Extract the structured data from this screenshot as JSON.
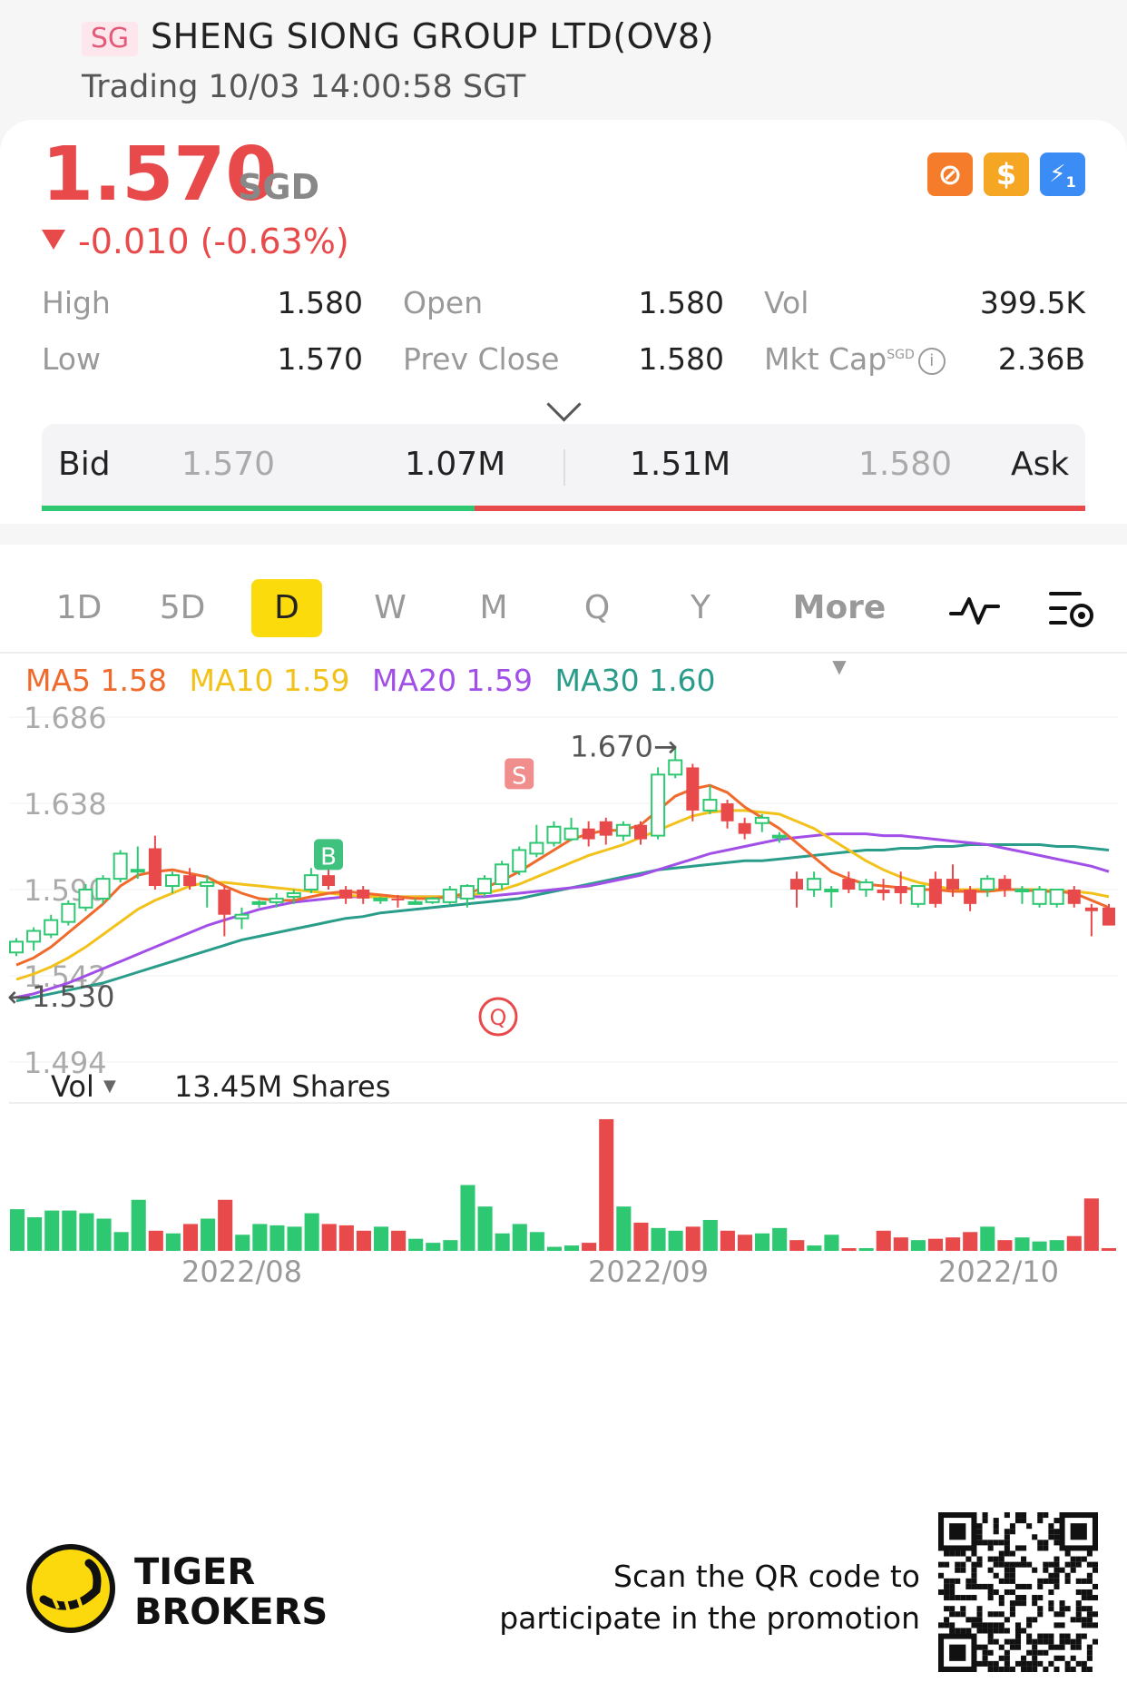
{
  "header": {
    "market_badge": "SG",
    "stock_name": "SHENG SIONG GROUP LTD(OV8)",
    "status": "Trading 10/03 14:00:58 SGT"
  },
  "quote": {
    "price": "1.570",
    "currency": "SGD",
    "change": "-0.010 (-0.63%)",
    "badges": [
      "prohibited-icon",
      "dollar-icon",
      "lightning-icon"
    ],
    "badge_colors": [
      "#f57c2b",
      "#f5a623",
      "#3b8cf5"
    ],
    "lightning_sub": "1"
  },
  "stats": {
    "high_label": "High",
    "high": "1.580",
    "low_label": "Low",
    "low": "1.570",
    "open_label": "Open",
    "open": "1.580",
    "prev_close_label": "Prev Close",
    "prev_close": "1.580",
    "vol_label": "Vol",
    "vol": "399.5K",
    "mkt_cap_label": "Mkt Cap",
    "mkt_cap_sup": "SGD",
    "mkt_cap": "2.36B"
  },
  "bidask": {
    "bid_label": "Bid",
    "bid_price": "1.570",
    "bid_size": "1.07M",
    "ask_size": "1.51M",
    "ask_price": "1.580",
    "ask_label": "Ask",
    "bid_ratio": 0.415
  },
  "tabs": [
    "1D",
    "5D",
    "D",
    "W",
    "M",
    "Q",
    "Y",
    "More"
  ],
  "active_tab": "D",
  "ma_legend": {
    "ma5": "MA5 1.58",
    "ma10": "MA10 1.59",
    "ma20": "MA20 1.59",
    "ma30": "MA30 1.60"
  },
  "chart_data": {
    "type": "candlestick",
    "y_ticks": [
      "1.686",
      "1.638",
      "1.590",
      "1.542",
      "1.494"
    ],
    "ylim": [
      1.494,
      1.686
    ],
    "annotations": {
      "high": "1.670",
      "low": "1.530",
      "buy": "B",
      "sell": "S",
      "q": "Q"
    },
    "x_labels": [
      "2022/08",
      "2022/09",
      "2022/10"
    ],
    "colors": {
      "up": "#2fc872",
      "down": "#e8494a",
      "ma5": "#f06a2c",
      "ma10": "#f2c21b",
      "ma20": "#a24fe8",
      "ma30": "#2a9d8a"
    },
    "candles": [
      {
        "o": 1.555,
        "h": 1.563,
        "l": 1.553,
        "c": 1.561
      },
      {
        "o": 1.561,
        "h": 1.569,
        "l": 1.556,
        "c": 1.567
      },
      {
        "o": 1.565,
        "h": 1.576,
        "l": 1.563,
        "c": 1.573
      },
      {
        "o": 1.572,
        "h": 1.584,
        "l": 1.57,
        "c": 1.582
      },
      {
        "o": 1.58,
        "h": 1.593,
        "l": 1.578,
        "c": 1.59
      },
      {
        "o": 1.585,
        "h": 1.598,
        "l": 1.582,
        "c": 1.596
      },
      {
        "o": 1.596,
        "h": 1.612,
        "l": 1.594,
        "c": 1.61
      },
      {
        "o": 1.6,
        "h": 1.614,
        "l": 1.596,
        "c": 1.601
      },
      {
        "o": 1.613,
        "h": 1.62,
        "l": 1.59,
        "c": 1.592
      },
      {
        "o": 1.592,
        "h": 1.6,
        "l": 1.588,
        "c": 1.598
      },
      {
        "o": 1.598,
        "h": 1.602,
        "l": 1.59,
        "c": 1.592
      },
      {
        "o": 1.592,
        "h": 1.598,
        "l": 1.58,
        "c": 1.594
      },
      {
        "o": 1.59,
        "h": 1.592,
        "l": 1.564,
        "c": 1.576
      },
      {
        "o": 1.574,
        "h": 1.58,
        "l": 1.568,
        "c": 1.576
      },
      {
        "o": 1.582,
        "h": 1.584,
        "l": 1.58,
        "c": 1.583
      },
      {
        "o": 1.583,
        "h": 1.588,
        "l": 1.58,
        "c": 1.585
      },
      {
        "o": 1.586,
        "h": 1.59,
        "l": 1.582,
        "c": 1.588
      },
      {
        "o": 1.59,
        "h": 1.602,
        "l": 1.588,
        "c": 1.598
      },
      {
        "o": 1.598,
        "h": 1.602,
        "l": 1.59,
        "c": 1.592
      },
      {
        "o": 1.59,
        "h": 1.592,
        "l": 1.582,
        "c": 1.585
      },
      {
        "o": 1.59,
        "h": 1.592,
        "l": 1.582,
        "c": 1.585
      },
      {
        "o": 1.585,
        "h": 1.586,
        "l": 1.582,
        "c": 1.585
      },
      {
        "o": 1.585,
        "h": 1.587,
        "l": 1.58,
        "c": 1.584
      },
      {
        "o": 1.583,
        "h": 1.585,
        "l": 1.582,
        "c": 1.583
      },
      {
        "o": 1.583,
        "h": 1.586,
        "l": 1.582,
        "c": 1.585
      },
      {
        "o": 1.583,
        "h": 1.592,
        "l": 1.582,
        "c": 1.59
      },
      {
        "o": 1.585,
        "h": 1.593,
        "l": 1.58,
        "c": 1.592
      },
      {
        "o": 1.588,
        "h": 1.598,
        "l": 1.586,
        "c": 1.596
      },
      {
        "o": 1.593,
        "h": 1.606,
        "l": 1.59,
        "c": 1.604
      },
      {
        "o": 1.6,
        "h": 1.614,
        "l": 1.598,
        "c": 1.612
      },
      {
        "o": 1.61,
        "h": 1.626,
        "l": 1.608,
        "c": 1.616
      },
      {
        "o": 1.616,
        "h": 1.628,
        "l": 1.614,
        "c": 1.625
      },
      {
        "o": 1.618,
        "h": 1.63,
        "l": 1.617,
        "c": 1.624
      },
      {
        "o": 1.624,
        "h": 1.628,
        "l": 1.614,
        "c": 1.618
      },
      {
        "o": 1.628,
        "h": 1.63,
        "l": 1.615,
        "c": 1.62
      },
      {
        "o": 1.62,
        "h": 1.628,
        "l": 1.617,
        "c": 1.626
      },
      {
        "o": 1.626,
        "h": 1.628,
        "l": 1.615,
        "c": 1.618
      },
      {
        "o": 1.62,
        "h": 1.658,
        "l": 1.618,
        "c": 1.654
      },
      {
        "o": 1.654,
        "h": 1.67,
        "l": 1.652,
        "c": 1.662
      },
      {
        "o": 1.658,
        "h": 1.66,
        "l": 1.628,
        "c": 1.634
      },
      {
        "o": 1.634,
        "h": 1.648,
        "l": 1.632,
        "c": 1.64
      },
      {
        "o": 1.638,
        "h": 1.64,
        "l": 1.624,
        "c": 1.628
      },
      {
        "o": 1.627,
        "h": 1.63,
        "l": 1.618,
        "c": 1.621
      },
      {
        "o": 1.627,
        "h": 1.632,
        "l": 1.622,
        "c": 1.63
      },
      {
        "o": 1.62,
        "h": 1.622,
        "l": 1.616,
        "c": 1.62
      },
      {
        "o": 1.596,
        "h": 1.6,
        "l": 1.58,
        "c": 1.59
      },
      {
        "o": 1.59,
        "h": 1.6,
        "l": 1.586,
        "c": 1.596
      },
      {
        "o": 1.59,
        "h": 1.592,
        "l": 1.58,
        "c": 1.59
      },
      {
        "o": 1.596,
        "h": 1.6,
        "l": 1.588,
        "c": 1.59
      },
      {
        "o": 1.59,
        "h": 1.596,
        "l": 1.586,
        "c": 1.594
      },
      {
        "o": 1.59,
        "h": 1.596,
        "l": 1.584,
        "c": 1.588
      },
      {
        "o": 1.592,
        "h": 1.6,
        "l": 1.582,
        "c": 1.588
      },
      {
        "o": 1.582,
        "h": 1.592,
        "l": 1.58,
        "c": 1.592
      },
      {
        "o": 1.596,
        "h": 1.6,
        "l": 1.58,
        "c": 1.582
      },
      {
        "o": 1.596,
        "h": 1.604,
        "l": 1.586,
        "c": 1.59
      },
      {
        "o": 1.59,
        "h": 1.592,
        "l": 1.578,
        "c": 1.582
      },
      {
        "o": 1.59,
        "h": 1.598,
        "l": 1.586,
        "c": 1.596
      },
      {
        "o": 1.596,
        "h": 1.598,
        "l": 1.586,
        "c": 1.59
      },
      {
        "o": 1.59,
        "h": 1.592,
        "l": 1.582,
        "c": 1.59
      },
      {
        "o": 1.582,
        "h": 1.592,
        "l": 1.58,
        "c": 1.59
      },
      {
        "o": 1.582,
        "h": 1.59,
        "l": 1.58,
        "c": 1.59
      },
      {
        "o": 1.59,
        "h": 1.592,
        "l": 1.58,
        "c": 1.582
      },
      {
        "o": 1.58,
        "h": 1.582,
        "l": 1.564,
        "c": 1.578
      },
      {
        "o": 1.58,
        "h": 1.582,
        "l": 1.57,
        "c": 1.57
      }
    ],
    "ma5": [
      1.548,
      1.552,
      1.558,
      1.566,
      1.574,
      1.582,
      1.592,
      1.598,
      1.6,
      1.601,
      1.599,
      1.597,
      1.592,
      1.588,
      1.585,
      1.584,
      1.584,
      1.586,
      1.588,
      1.589,
      1.588,
      1.587,
      1.586,
      1.585,
      1.585,
      1.586,
      1.588,
      1.591,
      1.595,
      1.6,
      1.606,
      1.612,
      1.618,
      1.621,
      1.623,
      1.623,
      1.626,
      1.634,
      1.642,
      1.646,
      1.648,
      1.644,
      1.636,
      1.63,
      1.624,
      1.616,
      1.608,
      1.6,
      1.596,
      1.593,
      1.592,
      1.591,
      1.59,
      1.59,
      1.589,
      1.589,
      1.589,
      1.59,
      1.59,
      1.589,
      1.589,
      1.588,
      1.584,
      1.58
    ],
    "ma10": [
      1.54,
      1.543,
      1.547,
      1.552,
      1.558,
      1.565,
      1.572,
      1.579,
      1.584,
      1.588,
      1.592,
      1.594,
      1.594,
      1.593,
      1.592,
      1.591,
      1.59,
      1.589,
      1.588,
      1.587,
      1.586,
      1.586,
      1.586,
      1.586,
      1.586,
      1.586,
      1.587,
      1.588,
      1.59,
      1.593,
      1.597,
      1.601,
      1.605,
      1.609,
      1.612,
      1.615,
      1.619,
      1.623,
      1.627,
      1.631,
      1.633,
      1.634,
      1.634,
      1.633,
      1.632,
      1.628,
      1.624,
      1.618,
      1.612,
      1.606,
      1.601,
      1.597,
      1.594,
      1.592,
      1.59,
      1.59,
      1.59,
      1.59,
      1.59,
      1.59,
      1.589,
      1.589,
      1.588,
      1.586
    ],
    "ma20": [
      1.53,
      1.532,
      1.535,
      1.538,
      1.542,
      1.546,
      1.55,
      1.554,
      1.558,
      1.562,
      1.566,
      1.57,
      1.573,
      1.576,
      1.579,
      1.581,
      1.583,
      1.584,
      1.585,
      1.586,
      1.586,
      1.586,
      1.586,
      1.586,
      1.586,
      1.586,
      1.586,
      1.586,
      1.587,
      1.588,
      1.589,
      1.59,
      1.591,
      1.592,
      1.594,
      1.596,
      1.598,
      1.601,
      1.604,
      1.607,
      1.61,
      1.612,
      1.614,
      1.616,
      1.618,
      1.619,
      1.62,
      1.621,
      1.621,
      1.621,
      1.62,
      1.62,
      1.619,
      1.618,
      1.617,
      1.616,
      1.615,
      1.613,
      1.611,
      1.609,
      1.607,
      1.605,
      1.603,
      1.6
    ],
    "ma30": [
      1.528,
      1.53,
      1.532,
      1.534,
      1.536,
      1.538,
      1.541,
      1.544,
      1.547,
      1.55,
      1.553,
      1.556,
      1.559,
      1.562,
      1.564,
      1.566,
      1.568,
      1.57,
      1.572,
      1.574,
      1.575,
      1.577,
      1.578,
      1.579,
      1.58,
      1.581,
      1.582,
      1.583,
      1.584,
      1.585,
      1.587,
      1.589,
      1.591,
      1.593,
      1.595,
      1.597,
      1.599,
      1.601,
      1.602,
      1.603,
      1.604,
      1.605,
      1.606,
      1.606,
      1.607,
      1.608,
      1.609,
      1.61,
      1.611,
      1.612,
      1.612,
      1.613,
      1.613,
      1.614,
      1.614,
      1.615,
      1.615,
      1.615,
      1.615,
      1.615,
      1.614,
      1.614,
      1.613,
      1.612
    ],
    "volume_label": "Vol",
    "volume_total": "13.45M Shares",
    "volumes": [
      0.31,
      0.25,
      0.3,
      0.3,
      0.28,
      0.24,
      0.14,
      0.38,
      0.15,
      0.13,
      0.2,
      0.24,
      0.38,
      0.12,
      0.2,
      0.19,
      0.18,
      0.28,
      0.2,
      0.19,
      0.15,
      0.18,
      0.15,
      0.09,
      0.06,
      0.08,
      0.49,
      0.33,
      0.13,
      0.2,
      0.14,
      0.03,
      0.04,
      0.06,
      0.98,
      0.33,
      0.21,
      0.17,
      0.15,
      0.18,
      0.23,
      0.15,
      0.12,
      0.13,
      0.17,
      0.08,
      0.04,
      0.12,
      0.02,
      0.02,
      0.15,
      0.1,
      0.08,
      0.09,
      0.1,
      0.14,
      0.18,
      0.08,
      0.1,
      0.07,
      0.08,
      0.11,
      0.39,
      0.02
    ]
  },
  "footer": {
    "brand_line1": "TIGER",
    "brand_line2": "BROKERS",
    "promo_line1": "Scan the QR code to",
    "promo_line2": "participate in the promotion"
  }
}
